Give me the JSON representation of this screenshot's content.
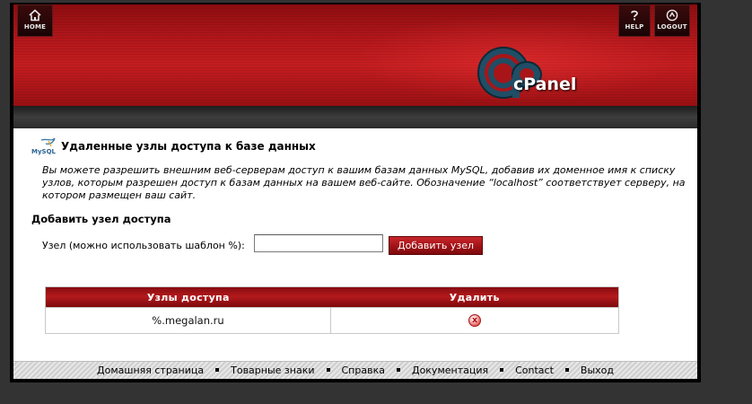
{
  "header": {
    "home_label": "HOME",
    "help_label": "HELP",
    "logout_label": "LOGOUT",
    "brand": "cPanel",
    "banner_color": "#b3171b"
  },
  "page": {
    "title": "Удаленные узлы доступа к базе данных",
    "description": "Вы можете разрешить внешним веб-серверам доступ к вашим базам данных MySQL, добавив их доменное имя к списку узлов, которым разрешен доступ к базам данных на вашем веб-сайте. Обозначение “localhost” соответствует серверу, на котором размещен ваш сайт.",
    "add_section_heading": "Добавить узел доступа",
    "host_field_label": "Узел (можно использовать шаблон %):",
    "host_field_value": "",
    "add_button_label": "Добавить узел"
  },
  "table": {
    "columns": [
      "Узлы доступа",
      "Удалить"
    ],
    "rows": [
      {
        "host": "%.megalan.ru",
        "delete_icon": "delete-x-icon"
      }
    ]
  },
  "footer": {
    "links": [
      "Домашняя страница",
      "Товарные знаки",
      "Справка",
      "Документация",
      "Contact",
      "Выход"
    ]
  }
}
